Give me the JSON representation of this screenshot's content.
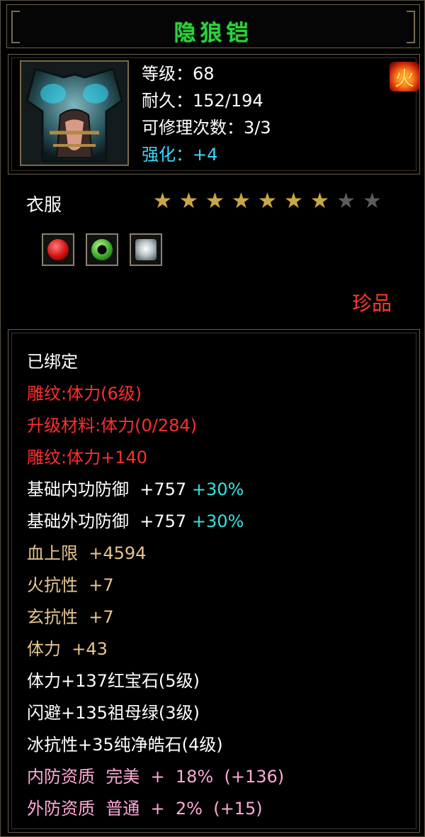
{
  "item": {
    "name": "隐狼铠",
    "stats": [
      {
        "label": "等级：68",
        "color": "white"
      },
      {
        "label": "耐久：152/194",
        "color": "white"
      },
      {
        "label": "可修理次数：3/3",
        "color": "white"
      },
      {
        "label": "强化：+4",
        "color": "cyan"
      }
    ],
    "icon": "armor-icon",
    "element_icon": "fire-icon",
    "category": "衣服",
    "stars": {
      "filled": 7,
      "total": 9
    },
    "gems": [
      "ruby-gem-icon",
      "emerald-gem-icon",
      "diamond-gem-icon"
    ],
    "quality": "珍品"
  },
  "properties": [
    {
      "text": "已绑定",
      "color": "white"
    },
    {
      "text": "雕纹:体力(6级)",
      "color": "red"
    },
    {
      "text": "升级材料:体力(0/284)",
      "color": "red"
    },
    {
      "text": "雕纹:体力+140",
      "color": "red"
    },
    {
      "text": "基础内功防御  +757",
      "suffix": "+30%",
      "color": "white"
    },
    {
      "text": "基础外功防御  +757",
      "suffix": "+30%",
      "color": "white"
    },
    {
      "text": "血上限  +4594",
      "color": "tan"
    },
    {
      "text": "火抗性  +7",
      "color": "tan"
    },
    {
      "text": "玄抗性  +7",
      "color": "tan"
    },
    {
      "text": "体力  +43",
      "color": "tan"
    },
    {
      "text": "体力+137红宝石(5级)",
      "color": "white"
    },
    {
      "text": "闪避+135祖母绿(3级)",
      "color": "white"
    },
    {
      "text": "冰抗性+35纯净皓石(4级)",
      "color": "white"
    },
    {
      "text": "内防资质  完美  +  18%  (+136)",
      "color": "pink"
    },
    {
      "text": "外防资质  普通  +  2%  (+15)",
      "color": "pink"
    }
  ],
  "colors": {
    "title": "#2fd23a",
    "red": "#ff2e2e",
    "tan": "#e8c690",
    "pink": "#ffa8d8",
    "cyan": "#2fe3e3",
    "star_on": "#c9a845",
    "star_off": "#5c5c5c"
  }
}
